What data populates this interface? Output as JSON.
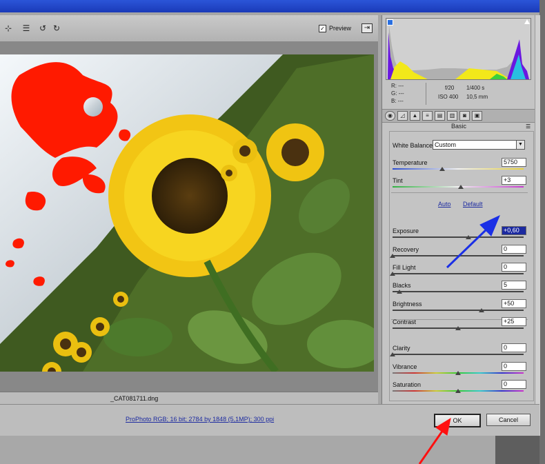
{
  "toolbar": {
    "preview_label": "Preview",
    "preview_checked": "✓",
    "tools": [
      "white-balance-tool",
      "list-tool",
      "rotate-left",
      "rotate-right"
    ]
  },
  "image": {
    "filename": "_CAT081711.dng"
  },
  "workflow": "ProPhoto RGB; 16 bit; 2784 by 1848 (5,1MP); 300 ppi",
  "buttons": {
    "ok": "OK",
    "cancel": "Cancel"
  },
  "readouts": {
    "r": "R:  ---",
    "g": "G:  ---",
    "b": "B:  ---",
    "aperture": "f/20",
    "shutter": "1/400 s",
    "iso": "ISO 400",
    "focal": "10,5 mm"
  },
  "panel": {
    "title": "Basic",
    "white_balance_label": "White Balance:",
    "white_balance_value": "Custom",
    "auto": "Auto",
    "default": "Default",
    "sliders": [
      {
        "label": "Temperature",
        "value": "5750",
        "position": 0.38
      },
      {
        "label": "Tint",
        "value": "+3",
        "position": 0.52
      },
      {
        "label": "Exposure",
        "value": "+0,60",
        "position": 0.58
      },
      {
        "label": "Recovery",
        "value": "0",
        "position": 0.0
      },
      {
        "label": "Fill Light",
        "value": "0",
        "position": 0.0
      },
      {
        "label": "Blacks",
        "value": "5",
        "position": 0.05
      },
      {
        "label": "Brightness",
        "value": "+50",
        "position": 0.68
      },
      {
        "label": "Contrast",
        "value": "+25",
        "position": 0.5
      },
      {
        "label": "Clarity",
        "value": "0",
        "position": 0.0
      },
      {
        "label": "Vibrance",
        "value": "0",
        "position": 0.5
      },
      {
        "label": "Saturation",
        "value": "0",
        "position": 0.5
      }
    ]
  },
  "colors": {
    "clip_warning": "#ff1a00",
    "annotation_blue": "#1a2fe6",
    "annotation_red": "#ff1010"
  }
}
